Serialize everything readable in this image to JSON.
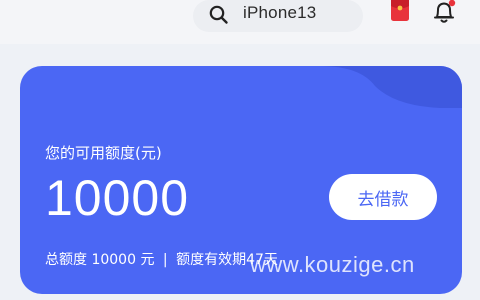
{
  "header": {
    "search": {
      "value": "iPhone13",
      "icon": "search-icon"
    },
    "icons": [
      "red-envelope-icon",
      "bell-icon"
    ],
    "colors": {
      "envelope": "#e8333b",
      "bell_badge": "#e8333b"
    }
  },
  "credit_card": {
    "label": "您的可用额度(元)",
    "amount": "10000",
    "button_label": "去借款",
    "footer": {
      "total_prefix": "总额度",
      "total_value": "10000",
      "total_unit": "元",
      "separator": "|",
      "validity_text": "额度有效期47天"
    },
    "colors": {
      "background": "#4b67f4",
      "wave": "#3f59e0",
      "button_bg": "#ffffff",
      "button_text": "#4b67f4"
    }
  },
  "watermark": {
    "text": "www.kouzige.cn"
  }
}
